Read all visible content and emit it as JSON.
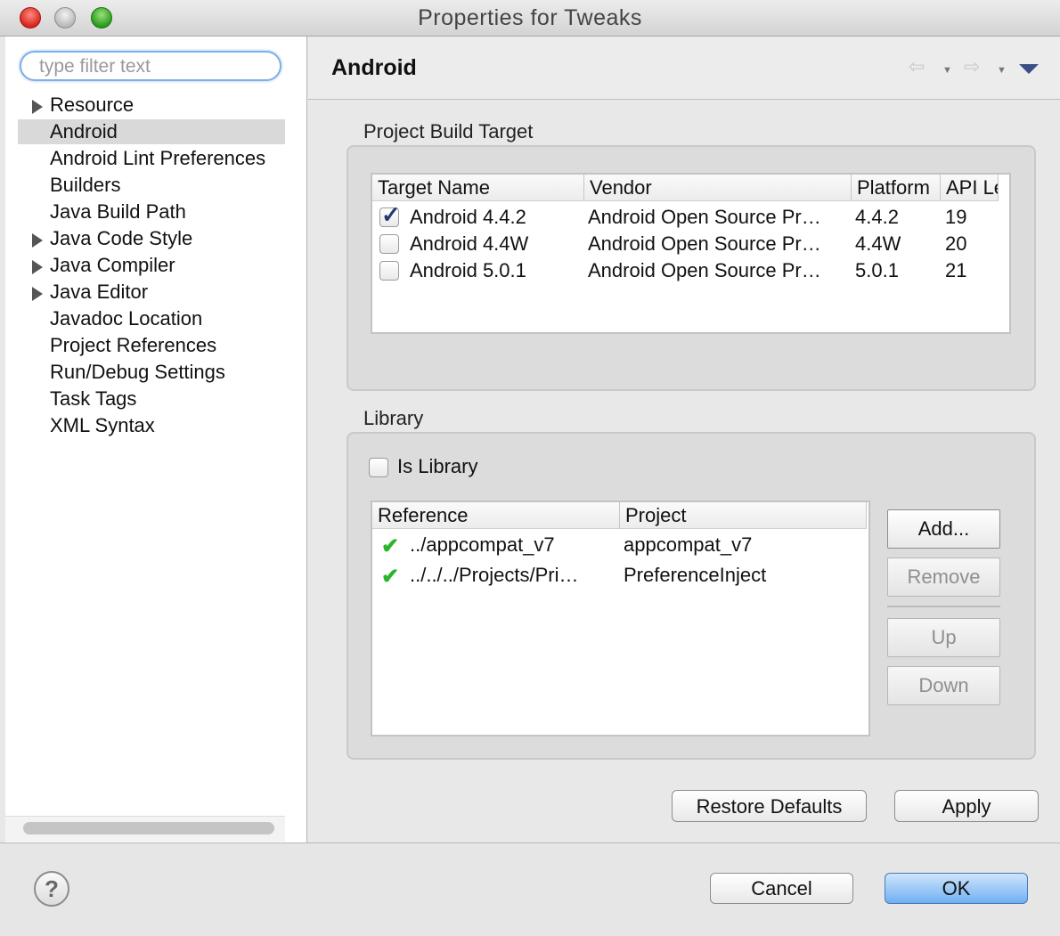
{
  "window": {
    "title": "Properties for Tweaks"
  },
  "filter": {
    "placeholder": "type filter text"
  },
  "tree": {
    "items": [
      {
        "label": "Resource",
        "expandable": true
      },
      {
        "label": "Android",
        "expandable": false,
        "selected": true
      },
      {
        "label": "Android Lint Preferences",
        "expandable": false
      },
      {
        "label": "Builders",
        "expandable": false
      },
      {
        "label": "Java Build Path",
        "expandable": false
      },
      {
        "label": "Java Code Style",
        "expandable": true
      },
      {
        "label": "Java Compiler",
        "expandable": true
      },
      {
        "label": "Java Editor",
        "expandable": true
      },
      {
        "label": "Javadoc Location",
        "expandable": false
      },
      {
        "label": "Project References",
        "expandable": false
      },
      {
        "label": "Run/Debug Settings",
        "expandable": false
      },
      {
        "label": "Task Tags",
        "expandable": false
      },
      {
        "label": "XML Syntax",
        "expandable": false
      }
    ]
  },
  "page": {
    "title": "Android"
  },
  "build_target": {
    "section_label": "Project Build Target",
    "columns": [
      "Target Name",
      "Vendor",
      "Platform",
      "API Le"
    ],
    "rows": [
      {
        "checked": true,
        "name": "Android 4.4.2",
        "vendor": "Android Open Source Pr…",
        "platform": "4.4.2",
        "api": "19"
      },
      {
        "checked": false,
        "name": "Android 4.4W",
        "vendor": "Android Open Source Pr…",
        "platform": "4.4W",
        "api": "20"
      },
      {
        "checked": false,
        "name": "Android 5.0.1",
        "vendor": "Android Open Source Pr…",
        "platform": "5.0.1",
        "api": "21"
      }
    ]
  },
  "library": {
    "section_label": "Library",
    "is_library_label": "Is Library",
    "is_library_checked": false,
    "columns": [
      "Reference",
      "Project"
    ],
    "rows": [
      {
        "reference": "../appcompat_v7",
        "project": "appcompat_v7"
      },
      {
        "reference": "../../../Projects/Pri…",
        "project": "PreferenceInject"
      }
    ],
    "buttons": {
      "add": "Add...",
      "remove": "Remove",
      "up": "Up",
      "down": "Down"
    }
  },
  "actions": {
    "restore_defaults": "Restore Defaults",
    "apply": "Apply"
  },
  "dialog_buttons": {
    "cancel": "Cancel",
    "ok": "OK",
    "help_glyph": "?"
  },
  "colors": {
    "ok_button": "#6fb0f2",
    "check_green": "#2bb52b",
    "selection": "#d9d9d9"
  }
}
